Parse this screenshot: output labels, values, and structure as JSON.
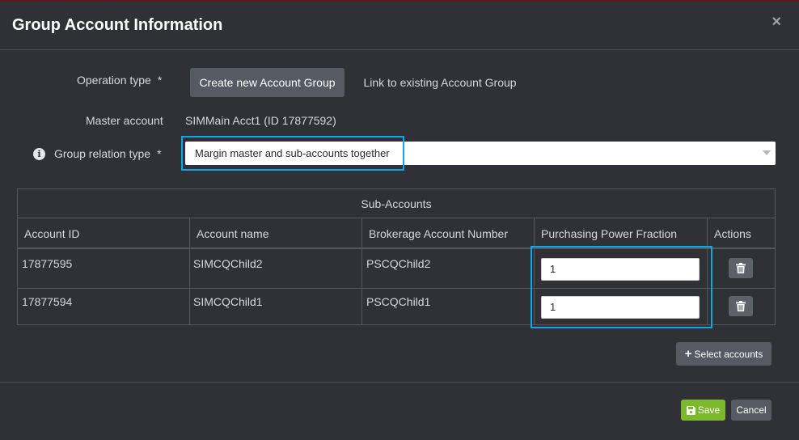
{
  "window": {
    "title": "Group Account Information",
    "close_glyph": "×"
  },
  "form": {
    "operation_type_label": "Operation type",
    "required_mark": "*",
    "operation_options": [
      "Create new Account Group",
      "Link to existing Account Group"
    ],
    "operation_selected": "Create new Account Group",
    "master_account_label": "Master account",
    "master_account_value": "SIMMain Acct1 (ID 17877592)",
    "group_relation_label": "Group relation type",
    "group_relation_value": "Margin master and sub-accounts together",
    "info_glyph": "i"
  },
  "subaccounts": {
    "caption": "Sub-Accounts",
    "columns": [
      "Account ID",
      "Account name",
      "Brokerage Account Number",
      "Purchasing Power Fraction",
      "Actions"
    ],
    "rows": [
      {
        "account_id": "17877595",
        "account_name": "SIMCQChild2",
        "brokerage_number": "PSCQChild2",
        "ppf": "1"
      },
      {
        "account_id": "17877594",
        "account_name": "SIMCQChild1",
        "brokerage_number": "PSCQChild1",
        "ppf": "1"
      }
    ]
  },
  "actions": {
    "select_accounts_label": "Select accounts",
    "plus_glyph": "+",
    "save_label": "Save",
    "cancel_label": "Cancel"
  },
  "colors": {
    "highlight": "#1aa3e0",
    "save_green": "#7ab929",
    "modal_bg": "#2f3136"
  },
  "icons": [
    "close-icon",
    "info-icon",
    "chevron-down-icon",
    "trash-icon",
    "plus-icon",
    "floppy-disk-icon"
  ]
}
